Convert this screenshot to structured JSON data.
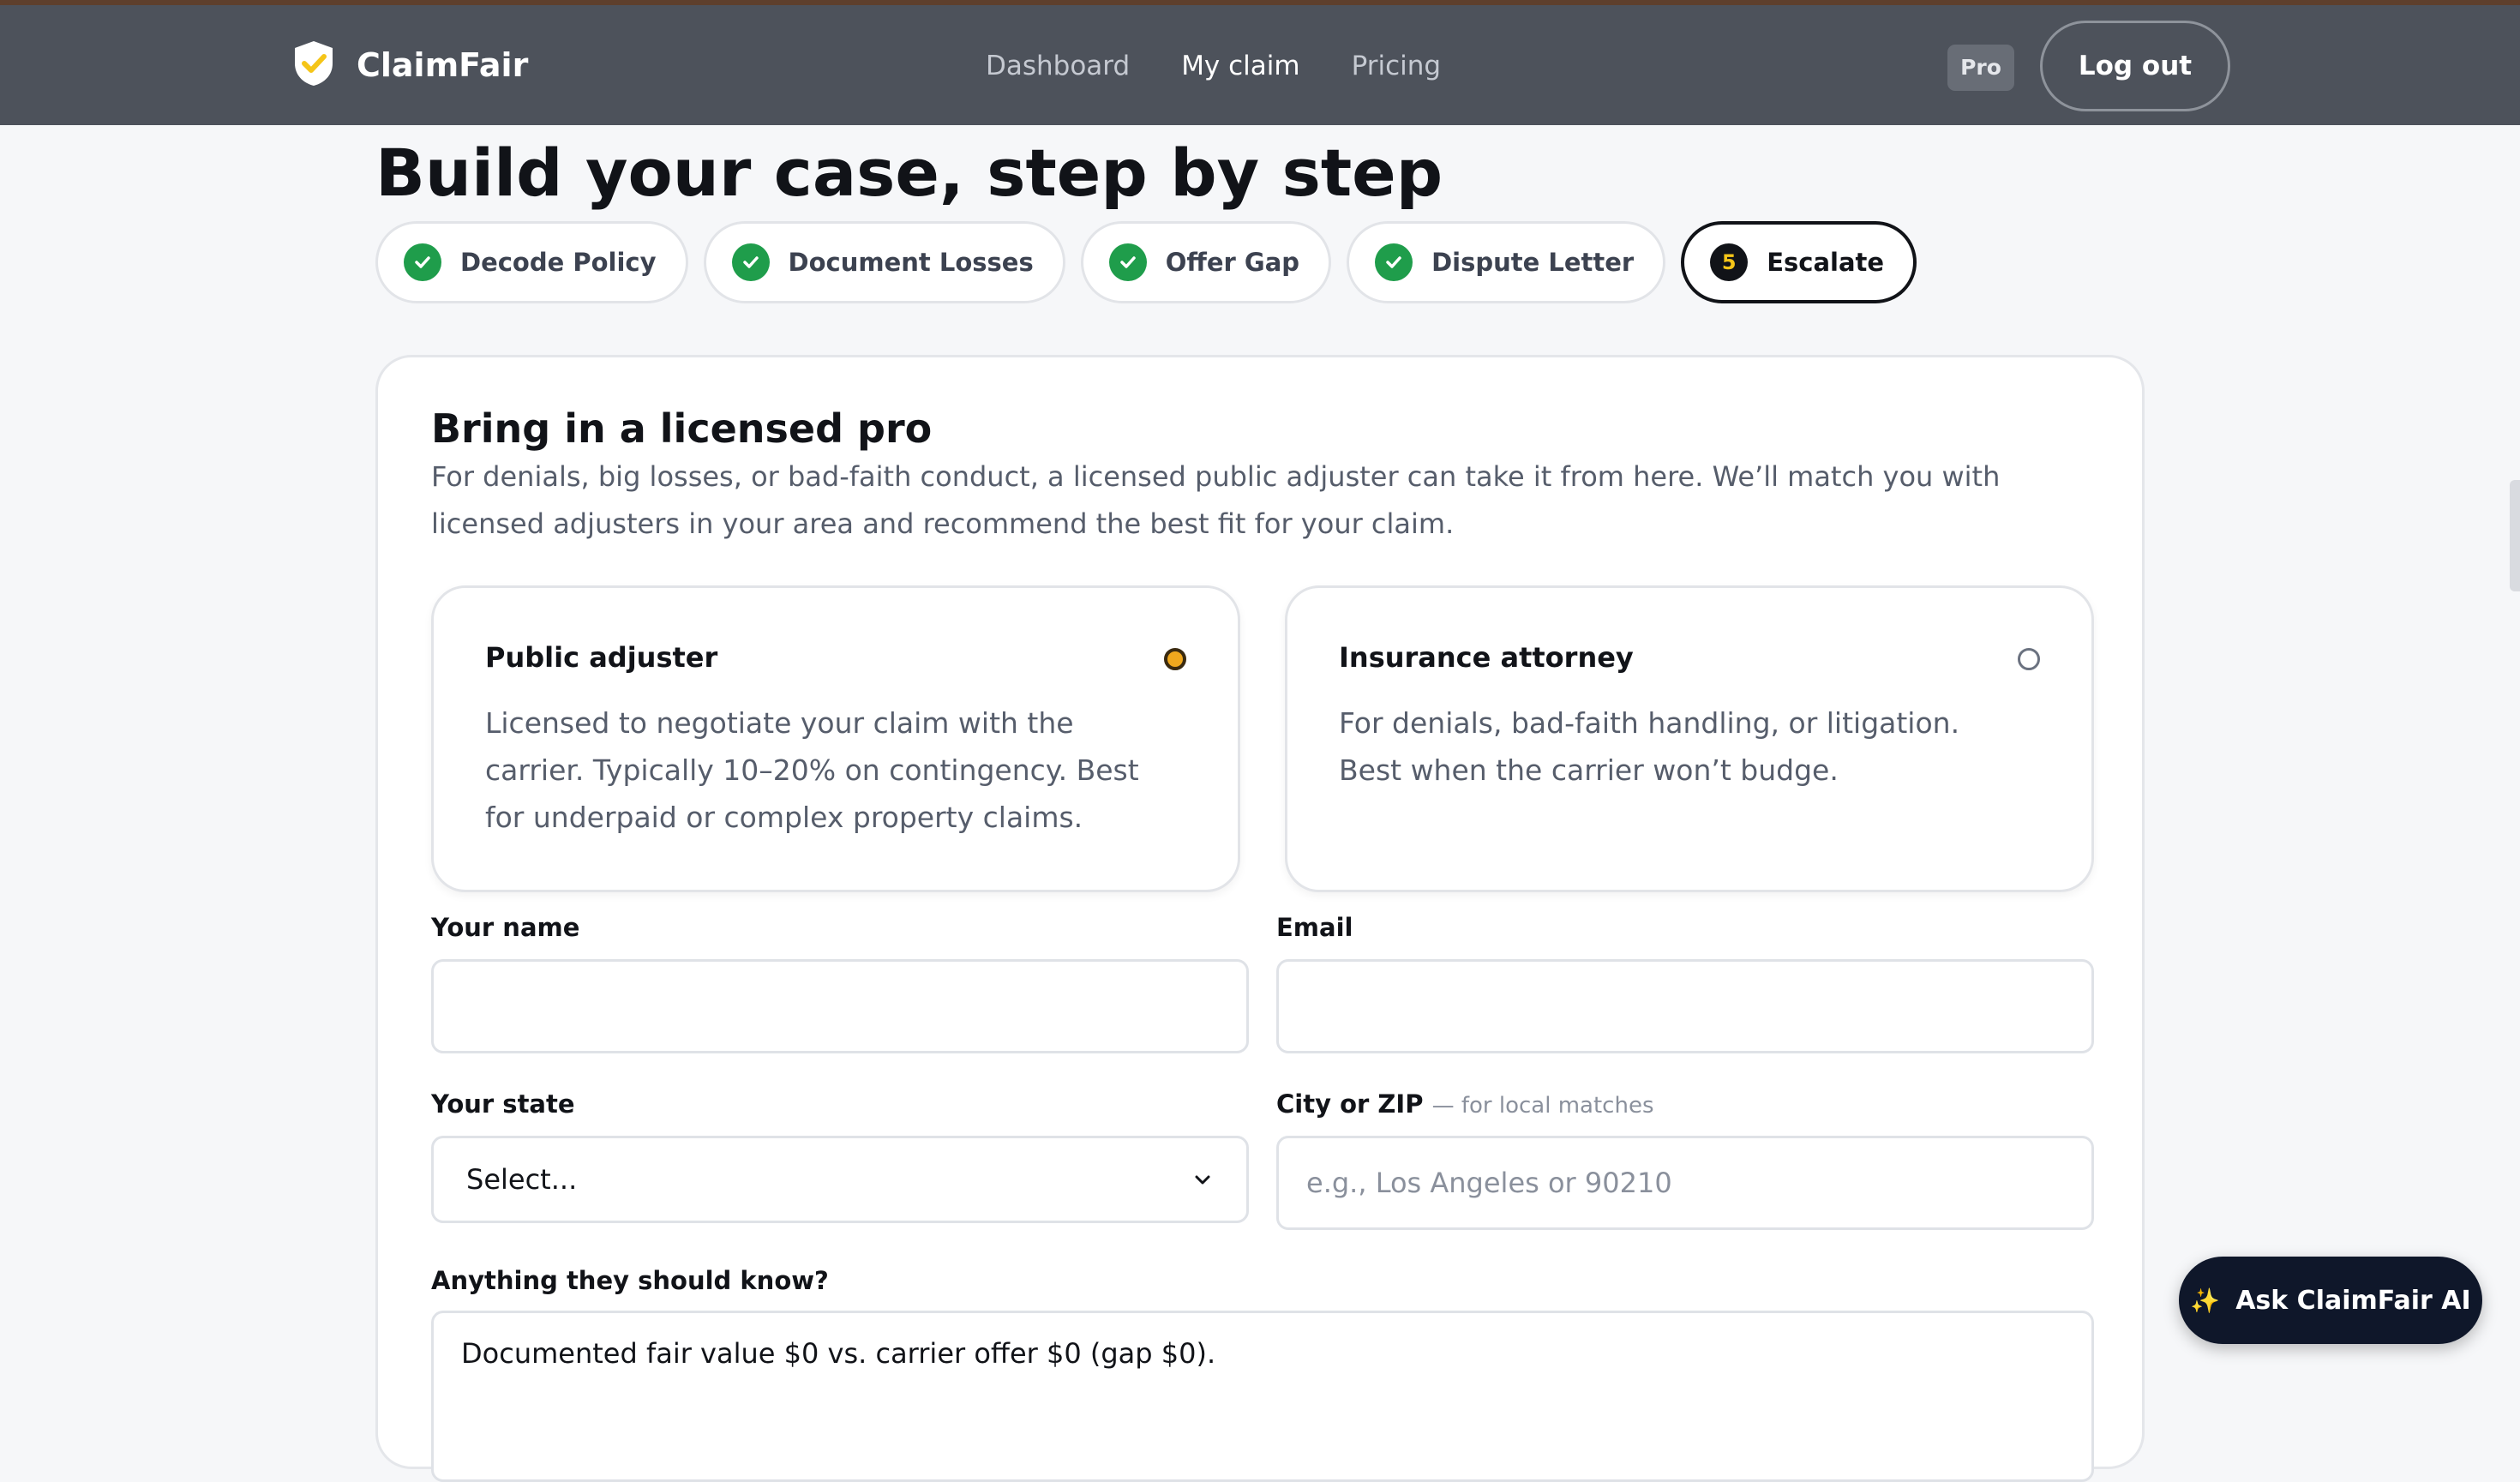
{
  "brand": {
    "name": "ClaimFair"
  },
  "nav": {
    "items": [
      "Dashboard",
      "My claim",
      "Pricing"
    ],
    "active": "My claim"
  },
  "header": {
    "badge": "Pro",
    "logout_label": "Log out"
  },
  "page": {
    "title": "Build your case, step by step"
  },
  "steps": [
    {
      "label": "Decode Policy",
      "status": "done"
    },
    {
      "label": "Document Losses",
      "status": "done"
    },
    {
      "label": "Offer Gap",
      "status": "done"
    },
    {
      "label": "Dispute Letter",
      "status": "done"
    },
    {
      "label": "Escalate",
      "status": "current",
      "number": "5"
    }
  ],
  "card": {
    "title": "Bring in a licensed pro",
    "description": "For denials, big losses, or bad-faith conduct, a licensed public adjuster can take it from here. We’ll match you with licensed adjusters in your area and recommend the best fit for your claim.",
    "options": [
      {
        "title": "Public adjuster",
        "description": "Licensed to negotiate your claim with the carrier. Typically 10–20% on contingency. Best for underpaid or complex property claims.",
        "selected": true
      },
      {
        "title": "Insurance attorney",
        "description": "For denials, bad-faith handling, or litigation. Best when the carrier won’t budge.",
        "selected": false
      }
    ],
    "form": {
      "name_label": "Your name",
      "name_value": "",
      "email_label": "Email",
      "email_value": "",
      "state_label": "Your state",
      "state_value": "Select...",
      "city_label": "City or ZIP",
      "city_hint": "— for local matches",
      "city_placeholder": "e.g., Los Angeles or 90210",
      "notes_label": "Anything they should know?",
      "notes_value": "Documented fair value $0 vs. carrier offer $0 (gap $0)."
    }
  },
  "assistant": {
    "label": "Ask ClaimFair AI"
  },
  "colors": {
    "accent": "#f5c518",
    "success": "#1f9d4b",
    "header_bg": "#4d525b",
    "dark": "#111318"
  }
}
